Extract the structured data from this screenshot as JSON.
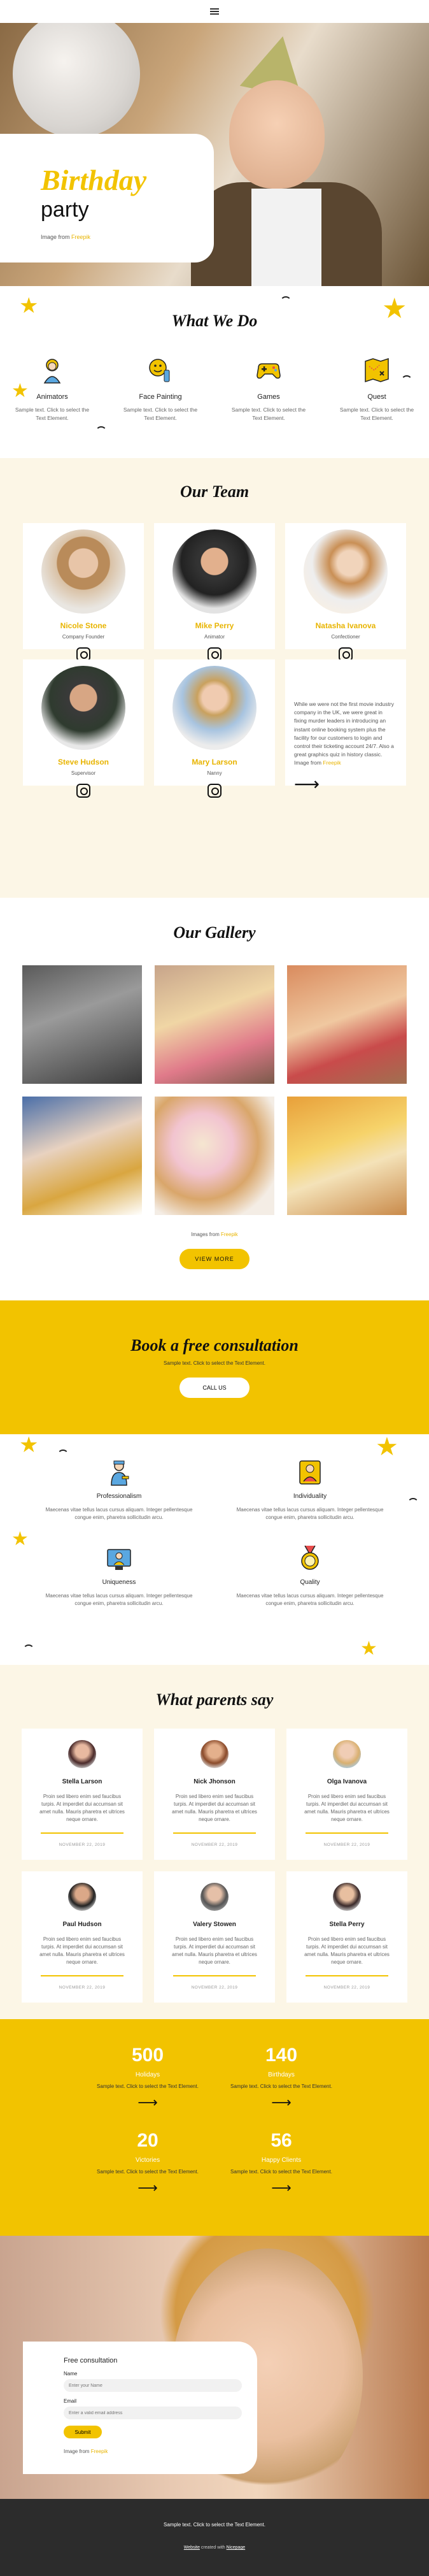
{
  "hero": {
    "title": "Birthday",
    "subtitle": "party",
    "credit_prefix": "Image from ",
    "credit_link": "Freepik"
  },
  "what_we_do": {
    "title": "What We Do",
    "items": [
      {
        "label": "Animators",
        "text": "Sample text. Click to select the Text Element.",
        "icon": "animator-icon"
      },
      {
        "label": "Face Painting",
        "text": "Sample text. Click to select the Text Element.",
        "icon": "face-painting-icon"
      },
      {
        "label": "Games",
        "text": "Sample text. Click to select the Text Element.",
        "icon": "gamepad-icon"
      },
      {
        "label": "Quest",
        "text": "Sample text. Click to select the Text Element.",
        "icon": "treasure-map-icon"
      }
    ]
  },
  "team": {
    "title": "Our Team",
    "members": [
      {
        "name": "Nicole Stone",
        "role": "Company Founder"
      },
      {
        "name": "Mike Perry",
        "role": "Animator"
      },
      {
        "name": "Natasha Ivanova",
        "role": "Confectioner"
      },
      {
        "name": "Steve Hudson",
        "role": "Supervisor"
      },
      {
        "name": "Mary Larson",
        "role": "Nanny"
      }
    ],
    "about_text": "While we were not the first movie industry company in the UK, we were great in fixing murder leaders in introducing an instant online booking system plus the facility for our customers to login and control their ticketing account 24/7. Also a great graphics quiz in history classic.",
    "about_credit_prefix": "Image from ",
    "about_credit_link": "Freepik"
  },
  "gallery": {
    "title": "Our Gallery",
    "credit_prefix": "Images from ",
    "credit_link": "Freepik",
    "button": "VIEW MORE"
  },
  "consultation": {
    "title": "Book a free consultation",
    "text": "Sample text. Click to select the Text Element.",
    "button": "CALL US"
  },
  "values": {
    "items": [
      {
        "label": "Professionalism",
        "text": "Maecenas vitae tellus lacus cursus aliquam. Integer pellentesque congue enim, pharetra sollicitudin arcu.",
        "icon": "professional-icon"
      },
      {
        "label": "Individuality",
        "text": "Maecenas vitae tellus lacus cursus aliquam. Integer pellentesque congue enim, pharetra sollicitudin arcu.",
        "icon": "individuality-icon"
      },
      {
        "label": "Uniqueness",
        "text": "Maecenas vitae tellus lacus cursus aliquam. Integer pellentesque congue enim, pharetra sollicitudin arcu.",
        "icon": "uniqueness-icon"
      },
      {
        "label": "Quality",
        "text": "Maecenas vitae tellus lacus cursus aliquam. Integer pellentesque congue enim, pharetra sollicitudin arcu.",
        "icon": "quality-medal-icon"
      }
    ]
  },
  "parents": {
    "title": "What parents say",
    "reviews": [
      {
        "name": "Stella Larson",
        "text": "Proin sed libero enim sed faucibus turpis. At imperdiet dui accumsan sit amet nulla. Mauris pharetra et ultrices neque ornare.",
        "date": "NOVEMBER 22, 2019"
      },
      {
        "name": "Nick Jhonson",
        "text": "Proin sed libero enim sed faucibus turpis. At imperdiet dui accumsan sit amet nulla. Mauris pharetra et ultrices neque ornare.",
        "date": "NOVEMBER 22, 2019"
      },
      {
        "name": "Olga Ivanova",
        "text": "Proin sed libero enim sed faucibus turpis. At imperdiet dui accumsan sit amet nulla. Mauris pharetra et ultrices neque ornare.",
        "date": "NOVEMBER 22, 2019"
      },
      {
        "name": "Paul Hudson",
        "text": "Proin sed libero enim sed faucibus turpis. At imperdiet dui accumsan sit amet nulla. Mauris pharetra et ultrices neque ornare.",
        "date": "NOVEMBER 22, 2019"
      },
      {
        "name": "Valery Stowen",
        "text": "Proin sed libero enim sed faucibus turpis. At imperdiet dui accumsan sit amet nulla. Mauris pharetra et ultrices neque ornare.",
        "date": "NOVEMBER 22, 2019"
      },
      {
        "name": "Stella Perry",
        "text": "Proin sed libero enim sed faucibus turpis. At imperdiet dui accumsan sit amet nulla. Mauris pharetra et ultrices neque ornare.",
        "date": "NOVEMBER 22, 2019"
      }
    ]
  },
  "stats": {
    "items": [
      {
        "num": "500",
        "label": "Holidays",
        "text": "Sample text. Click to select the Text Element."
      },
      {
        "num": "140",
        "label": "Birthdays",
        "text": "Sample text. Click to select the Text Element."
      },
      {
        "num": "20",
        "label": "Victories",
        "text": "Sample text. Click to select the Text Element."
      },
      {
        "num": "56",
        "label": "Happy Clients",
        "text": "Sample text. Click to select the Text Element."
      }
    ]
  },
  "contact": {
    "title": "Free consultation",
    "name_label": "Name",
    "name_placeholder": "Enter your Name",
    "email_label": "Email",
    "email_placeholder": "Enter a valid email address",
    "submit": "Submit",
    "credit_prefix": "Image from ",
    "credit_link": "Freepik"
  },
  "footer": {
    "text": "Sample text. Click to select the Text Element.",
    "builder_link": "Website",
    "builder_mid": " created with ",
    "builder_brand": "Nicepage"
  },
  "colors": {
    "accent": "#f2c300",
    "cream": "#fcf6e6",
    "footer": "#2c2c2c"
  }
}
